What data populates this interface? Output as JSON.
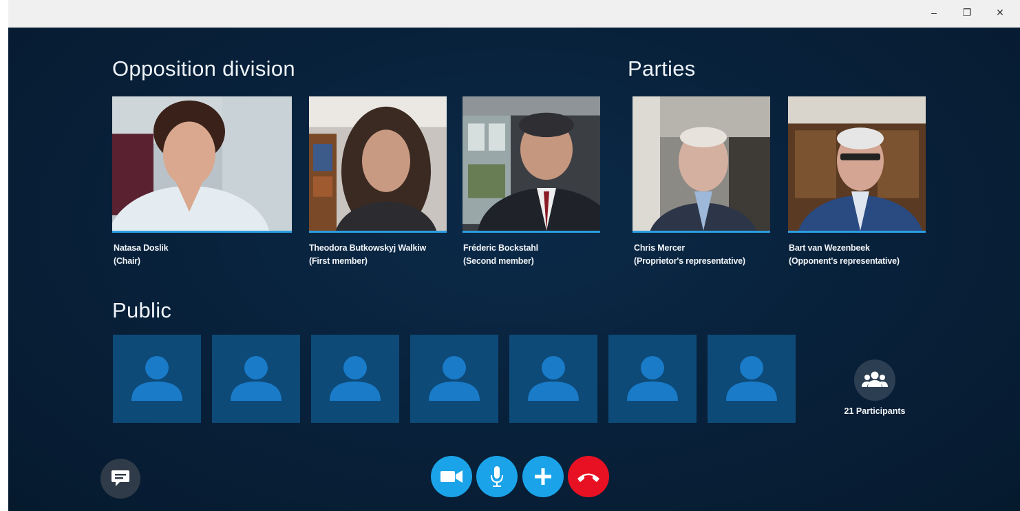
{
  "window": {
    "minimize_glyph": "–",
    "restore_glyph": "❐",
    "close_glyph": "✕"
  },
  "sections": {
    "opposition": "Opposition division",
    "parties": "Parties",
    "public": "Public"
  },
  "participants": [
    {
      "name": "Natasa Doslik",
      "role": "(Chair)"
    },
    {
      "name": "Theodora Butkowskyj Walkiw",
      "role": "(First member)"
    },
    {
      "name": "Fréderic Bockstahl",
      "role": "(Second member)"
    },
    {
      "name": "Chris Mercer",
      "role": "(Proprietor's representative)"
    },
    {
      "name": "Bart van Wezenbeek",
      "role": "(Opponent's  representative)"
    }
  ],
  "public": {
    "tile_count": 7,
    "tile_icon": "person-avatar-icon",
    "participants_label": "21 Participants",
    "participants_icon": "group-icon"
  },
  "controls": {
    "chat_icon": "chat-bubble-icon",
    "video_icon": "video-camera-icon",
    "mic_icon": "microphone-icon",
    "add_icon": "plus-icon",
    "hangup_icon": "hang-up-icon"
  },
  "colors": {
    "stage_bg": "#082039",
    "accent_blue": "#1aa3e8",
    "hangup_red": "#e81123",
    "public_tile": "#0d4a78",
    "public_avatar": "#1a7bc8"
  }
}
